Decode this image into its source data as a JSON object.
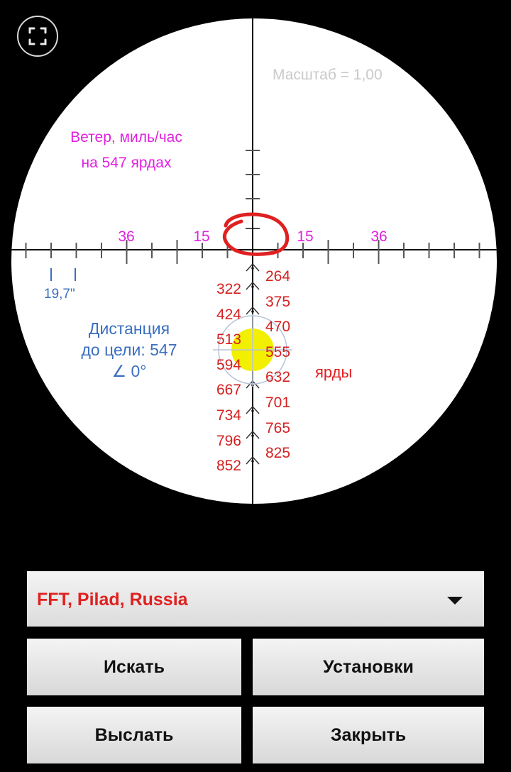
{
  "reticle": {
    "scale_text": "Масштаб = 1,00",
    "wind_line1": "Ветер, миль/час",
    "wind_line2": "на 547 ярдах",
    "wind_marks": [
      "36",
      "15",
      "15",
      "36"
    ],
    "small_size_label": "19,7\"",
    "distance_line1": "Дистанция",
    "distance_line2": "до цели: 547",
    "angle_text": "∠ 0°",
    "units_label": "ярды",
    "ranges_left": [
      "322",
      "424",
      "513",
      "594",
      "667",
      "734",
      "796",
      "852"
    ],
    "ranges_right": [
      "264",
      "375",
      "470",
      "555",
      "632",
      "701",
      "765",
      "825"
    ]
  },
  "colors": {
    "wind": "#e020e0",
    "range": "#d42020",
    "distance": "#3a6fc0",
    "target": "#f2f000",
    "annotation": "#e02020"
  },
  "icons": {
    "fullscreen": "fullscreen-icon",
    "dropdown": "triangle-down-icon"
  },
  "controls": {
    "profile_select": "FFT, Pilad, Russia",
    "search_button": "Искать",
    "settings_button": "Установки",
    "send_button": "Выслать",
    "close_button": "Закрыть"
  }
}
